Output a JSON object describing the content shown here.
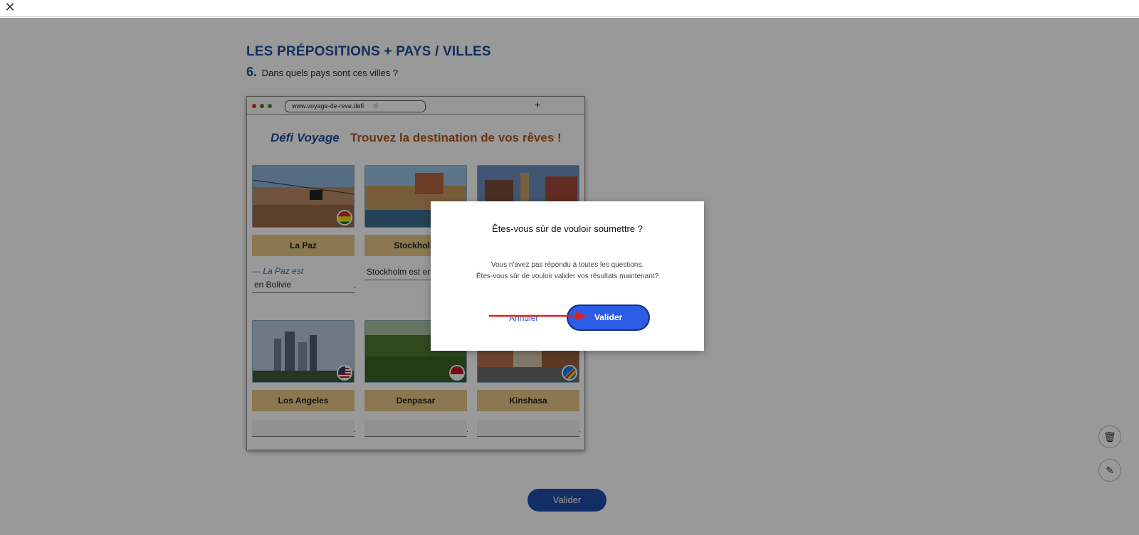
{
  "topbar": {
    "close_glyph": "✕"
  },
  "exercise": {
    "title": "LES PRÉPOSITIONS + PAYS / VILLES",
    "question_number": "6.",
    "question_text": "Dans quels pays sont ces villes ?"
  },
  "browser": {
    "url": "www.voyage-de-reve.defi",
    "star_glyph": "☆",
    "plus_glyph": "+",
    "site_logo": "Défi Voyage",
    "site_tagline": "Trouvez la destination de vos rêves !"
  },
  "cards": [
    {
      "city": "La Paz",
      "hint": "— La Paz est",
      "answer": "en Bolivie"
    },
    {
      "city": "Stockholm",
      "answer": "Stockholm est en"
    },
    {
      "city": "",
      "answer": ""
    },
    {
      "city": "Los Angeles",
      "answer": ""
    },
    {
      "city": "Denpasar",
      "answer": ""
    },
    {
      "city": "Kinshasa",
      "answer": ""
    }
  ],
  "answer_period": ".",
  "bottom": {
    "submit_label": "Valider"
  },
  "side_tools": {
    "trash_glyph": "🗑",
    "edit_glyph": "✎"
  },
  "modal": {
    "title": "Êtes-vous sûr de vouloir soumettre ?",
    "message_line1": "Vous n'avez pas répondu à toutes les questions.",
    "message_line2": "Êtes-vous sûr de vouloir valider vos résultats maintenant?",
    "cancel_label": "Annuler",
    "confirm_label": "Valider"
  },
  "colors": {
    "accent": "#1d4f9c",
    "confirm": "#2b5ce6",
    "annotation_arrow": "#e02020"
  }
}
